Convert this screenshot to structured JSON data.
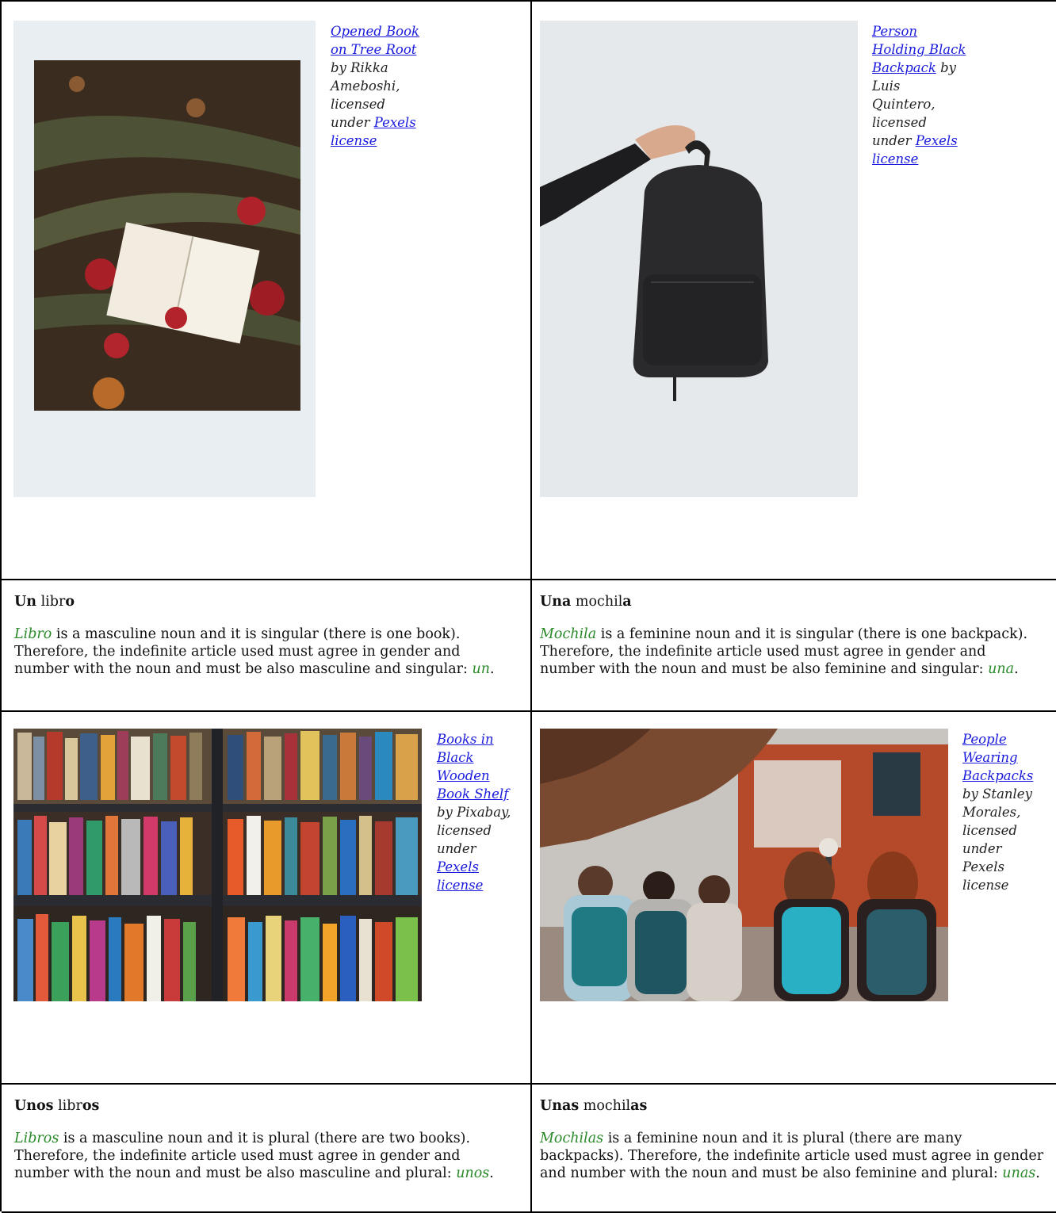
{
  "cells": [
    {
      "caption": {
        "link": "Opened Book on Tree Root",
        "by": " by Rikka Ameboshi, licensed under ",
        "license": "Pexels license"
      }
    },
    {
      "caption": {
        "link": "Person Holding Black Backpack",
        "by": " by Luis Quintero, licensed under ",
        "license": "Pexels license"
      }
    },
    {
      "caption": {
        "link": "Books in Black Wooden Book Shelf",
        "by": " by Pixabay, licensed under ",
        "license": "Pexels license"
      }
    },
    {
      "caption": {
        "link": "People Wearing Backpacks",
        "by": " by Stanley Morales, licensed under Pexels license"
      }
    }
  ],
  "explanations": [
    {
      "title_article": "Un",
      "title_stem": " libr",
      "title_ending": "o",
      "noun": "Libro",
      "body": " is a masculine noun and it is singular (there is one book). Therefore, the indefinite article used must agree in gender and number with the noun and must be also masculine and singular: ",
      "answer": "un",
      "end": "."
    },
    {
      "title_article": "Una",
      "title_stem": " mochil",
      "title_ending": "a",
      "noun": "Mochila",
      "body": " is a feminine noun and it is singular (there is one backpack). Therefore, the indefinite article used must agree in gender and number with the noun and must be also feminine and singular: ",
      "answer": "una",
      "end": "."
    },
    {
      "title_article": "Unos",
      "title_stem": " libr",
      "title_ending": "os",
      "noun": "Libros",
      "body": " is a masculine noun and it is plural (there are two books). Therefore, the indefinite article used must agree in gender and number with the noun and must be also masculine and plural: ",
      "answer": "unos",
      "end": "."
    },
    {
      "title_article": "Unas",
      "title_stem": " mochil",
      "title_ending": "as",
      "noun": "Mochilas",
      "body": " is a feminine noun and it is plural (there are many backpacks). Therefore, the indefinite article used must agree in gender and number with the noun and must be also feminine and plural: ",
      "answer": "unas",
      "end": "."
    }
  ],
  "colors": {
    "link": "#1a1adc",
    "green_term": "#2a8a2a",
    "border": "#000000"
  }
}
